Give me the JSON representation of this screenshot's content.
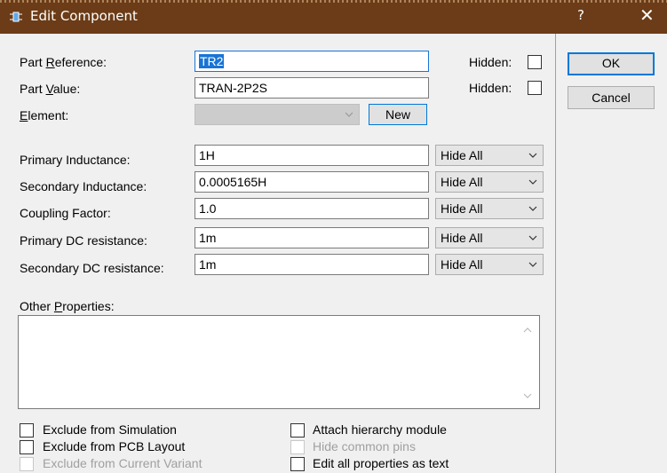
{
  "window": {
    "title": "Edit Component",
    "help_label": "?",
    "close_label": "✕"
  },
  "part_reference": {
    "label_pre": "Part ",
    "label_u": "R",
    "label_post": "eference:",
    "value": "TR2",
    "hidden_label": "Hidden:"
  },
  "part_value": {
    "label_pre": "Part ",
    "label_u": "V",
    "label_post": "alue:",
    "value": "TRAN-2P2S",
    "hidden_label": "Hidden:"
  },
  "element": {
    "label_u": "E",
    "label_post": "lement:",
    "value": "",
    "new_label": "New"
  },
  "properties": [
    {
      "label": "Primary Inductance:",
      "value": "1H",
      "visibility": "Hide All"
    },
    {
      "label": "Secondary Inductance:",
      "value": "0.0005165H",
      "visibility": "Hide All"
    },
    {
      "label": "Coupling Factor:",
      "value": "1.0",
      "visibility": "Hide All"
    },
    {
      "label": "Primary DC resistance:",
      "value": "1m",
      "visibility": "Hide All"
    },
    {
      "label": "Secondary DC resistance:",
      "value": "1m",
      "visibility": "Hide All"
    }
  ],
  "other_properties": {
    "label_pre": "Other ",
    "label_u": "P",
    "label_post": "roperties:",
    "value": ""
  },
  "checkboxes": {
    "exclude_simulation": "Exclude from Simulation",
    "exclude_pcb": "Exclude from PCB Layout",
    "exclude_variant": "Exclude from Current Variant",
    "attach_hierarchy": "Attach hierarchy module",
    "hide_common_pins": "Hide common pins",
    "edit_all_text": "Edit all properties as text"
  },
  "buttons": {
    "ok": "OK",
    "cancel": "Cancel"
  },
  "colors": {
    "titlebar": "#6b3c17",
    "selection": "#1874d6",
    "default_button_border": "#0078d7"
  }
}
